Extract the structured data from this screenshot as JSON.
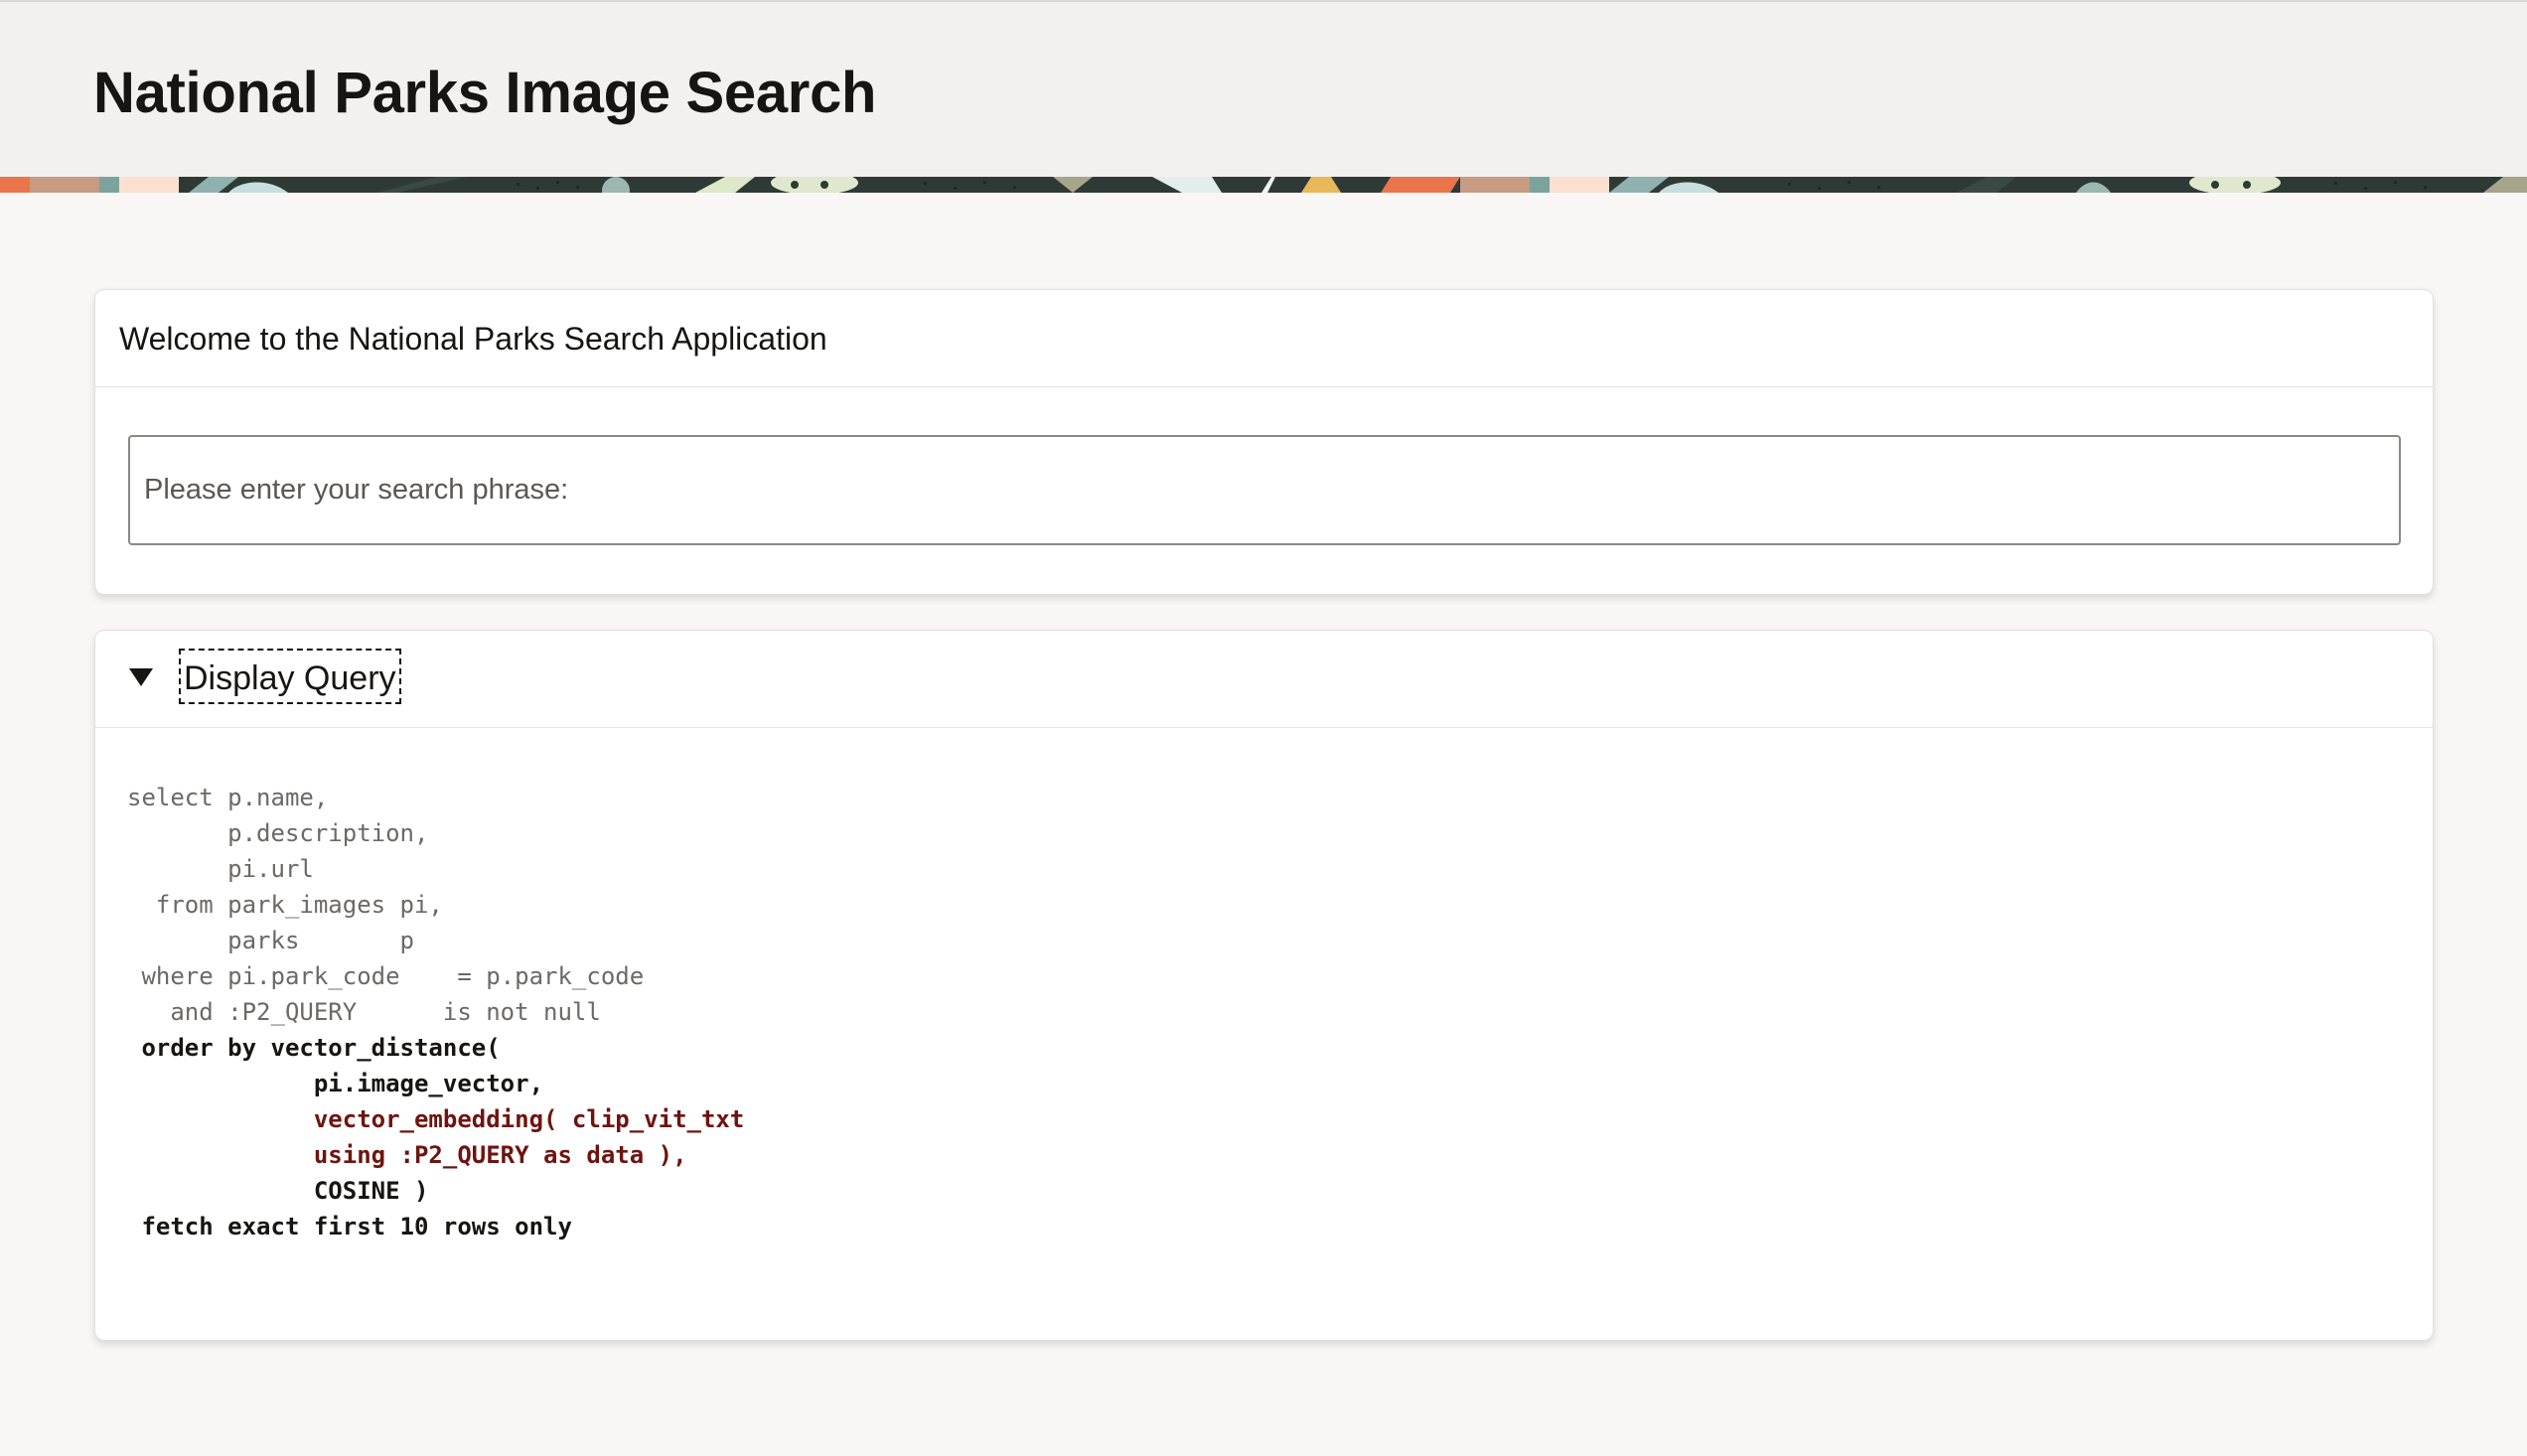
{
  "app": {
    "title": "National Parks Image Search"
  },
  "welcome_region": {
    "title": "Welcome to the National Parks Search Application",
    "search": {
      "placeholder": "Please enter your search phrase:",
      "value": ""
    }
  },
  "query_region": {
    "title": "Display Query",
    "expanded": true,
    "code_lines": [
      {
        "text": "select p.name,",
        "style": "plain"
      },
      {
        "text": "       p.description,",
        "style": "plain"
      },
      {
        "text": "       pi.url",
        "style": "plain"
      },
      {
        "text": "  from park_images pi,",
        "style": "plain"
      },
      {
        "text": "       parks       p",
        "style": "plain"
      },
      {
        "text": " where pi.park_code    = p.park_code",
        "style": "plain"
      },
      {
        "text": "   and :P2_QUERY      is not null",
        "style": "plain"
      },
      {
        "text": " order by vector_distance(",
        "style": "bold"
      },
      {
        "text": "             pi.image_vector,",
        "style": "bold"
      },
      {
        "text": "             vector_embedding( clip_vit_txt",
        "style": "red"
      },
      {
        "text": "             using :P2_QUERY as data ),",
        "style": "red"
      },
      {
        "text": "             COSINE )",
        "style": "bold"
      },
      {
        "text": " fetch exact first 10 rows only",
        "style": "bold"
      }
    ]
  },
  "colors": {
    "page_background": "#f8f7f5",
    "header_background": "#f2f1ef",
    "card_background": "#ffffff",
    "text_primary": "#161513",
    "code_plain": "#6b6967",
    "code_highlight": "#6e1410"
  },
  "icons": {
    "collapse_toggle": "caret-down-icon"
  }
}
